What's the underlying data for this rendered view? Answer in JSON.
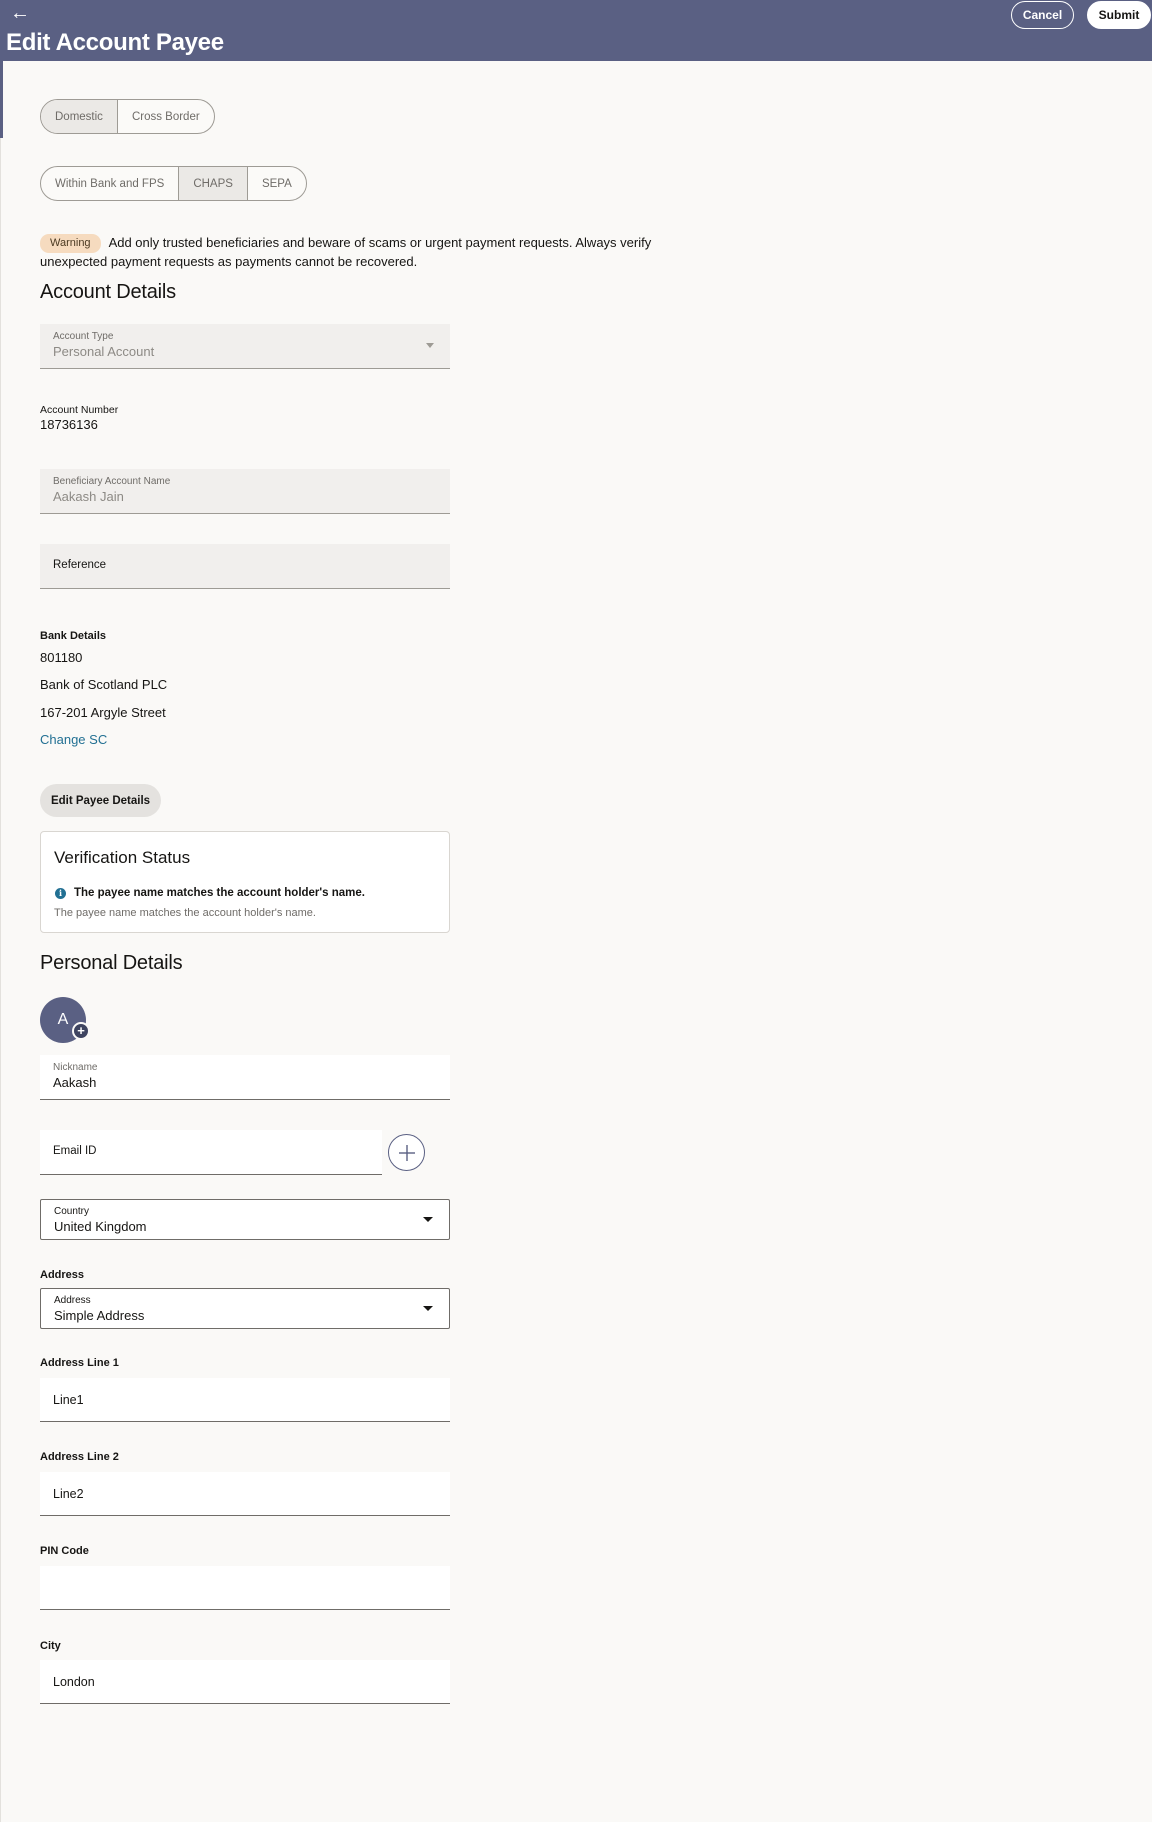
{
  "header": {
    "back_icon": "←",
    "title": "Edit Account Payee",
    "cancel_label": "Cancel",
    "submit_label": "Submit"
  },
  "region_toggle": {
    "options": [
      "Domestic",
      "Cross Border"
    ],
    "selected": "Domestic"
  },
  "network_toggle": {
    "options": [
      "Within Bank and FPS",
      "CHAPS",
      "SEPA"
    ],
    "selected": "CHAPS"
  },
  "warning": {
    "badge": "Warning",
    "text": "Add only trusted beneficiaries and beware of scams or urgent payment requests. Always verify unexpected payment requests as payments cannot be recovered."
  },
  "account_details": {
    "heading": "Account Details",
    "account_type_label": "Account Type",
    "account_type_value": "Personal Account",
    "account_number_label": "Account Number",
    "account_number_value": "18736136",
    "beneficiary_label": "Beneficiary Account Name",
    "beneficiary_value": "Aakash Jain",
    "reference_label": "Reference"
  },
  "bank_details": {
    "label": "Bank Details",
    "sort_code": "801180",
    "bank_name": "Bank of Scotland PLC",
    "address": "167-201 Argyle Street",
    "change_link": "Change SC"
  },
  "edit_payee_button": "Edit Payee Details",
  "verification": {
    "title": "Verification Status",
    "info_icon": "i",
    "message": "The payee name matches the account holder's name.",
    "subtext": "The payee name matches the account holder's name."
  },
  "personal_details": {
    "heading": "Personal Details",
    "avatar_initial": "A",
    "avatar_add": "+",
    "nickname_label": "Nickname",
    "nickname_value": "Aakash",
    "email_label": "Email ID",
    "country_label": "Country",
    "country_value": "United Kingdom",
    "address_section_label": "Address",
    "address_type_label": "Address",
    "address_type_value": "Simple Address",
    "line1_label": "Address Line 1",
    "line1_value": "Line1",
    "line2_label": "Address Line 2",
    "line2_value": "Line2",
    "pin_label": "PIN Code",
    "pin_value": "",
    "city_label": "City",
    "city_value": "London"
  },
  "colors": {
    "header_bg": "#5a6083",
    "link": "#227093",
    "warning_badge": "#f6dbbf",
    "page_bg": "#faf9f7"
  }
}
